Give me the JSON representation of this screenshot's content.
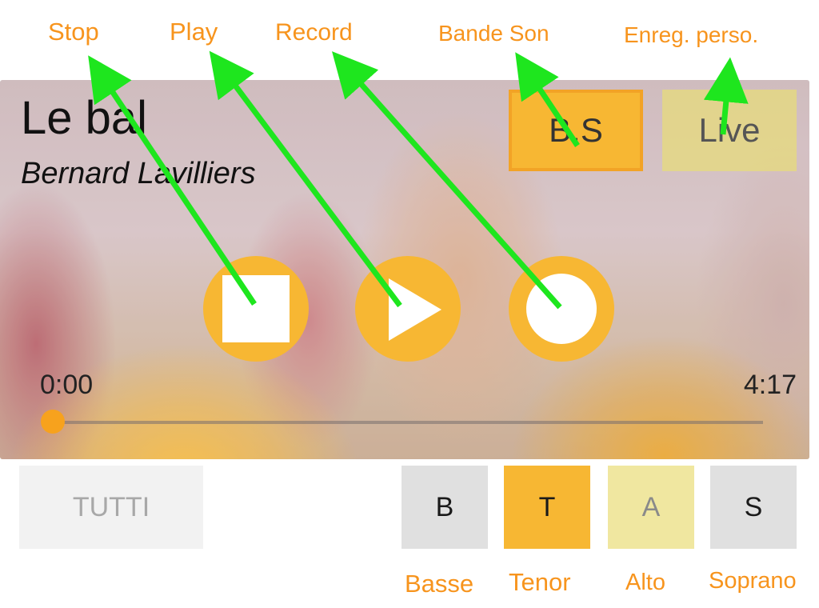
{
  "callouts": {
    "stop": "Stop",
    "play": "Play",
    "record": "Record",
    "bande_son": "Bande Son",
    "enreg_perso": "Enreg. perso.",
    "basse": "Basse",
    "tenor": "Tenor",
    "alto": "Alto",
    "soprano": "Soprano"
  },
  "player": {
    "song_title": "Le bal",
    "artist": "Bernard Lavilliers",
    "mode_buttons": {
      "backing_track": "B.S",
      "live": "Live",
      "active": "backing_track"
    },
    "controls": {
      "stop_icon": "stop-icon",
      "play_icon": "play-icon",
      "record_icon": "record-icon"
    },
    "time_elapsed": "0:00",
    "time_total": "4:17",
    "progress": 0
  },
  "voices": {
    "tutti": "TUTTI",
    "bass": "B",
    "tenor": "T",
    "alto": "A",
    "soprano": "S",
    "selected": "tenor"
  },
  "colors": {
    "accent": "#f7b733",
    "callout_text": "#f7941d",
    "annotation_arrow": "#1ee61e",
    "alto_tint": "#f0e7a0",
    "inactive": "#e0e0e0"
  }
}
